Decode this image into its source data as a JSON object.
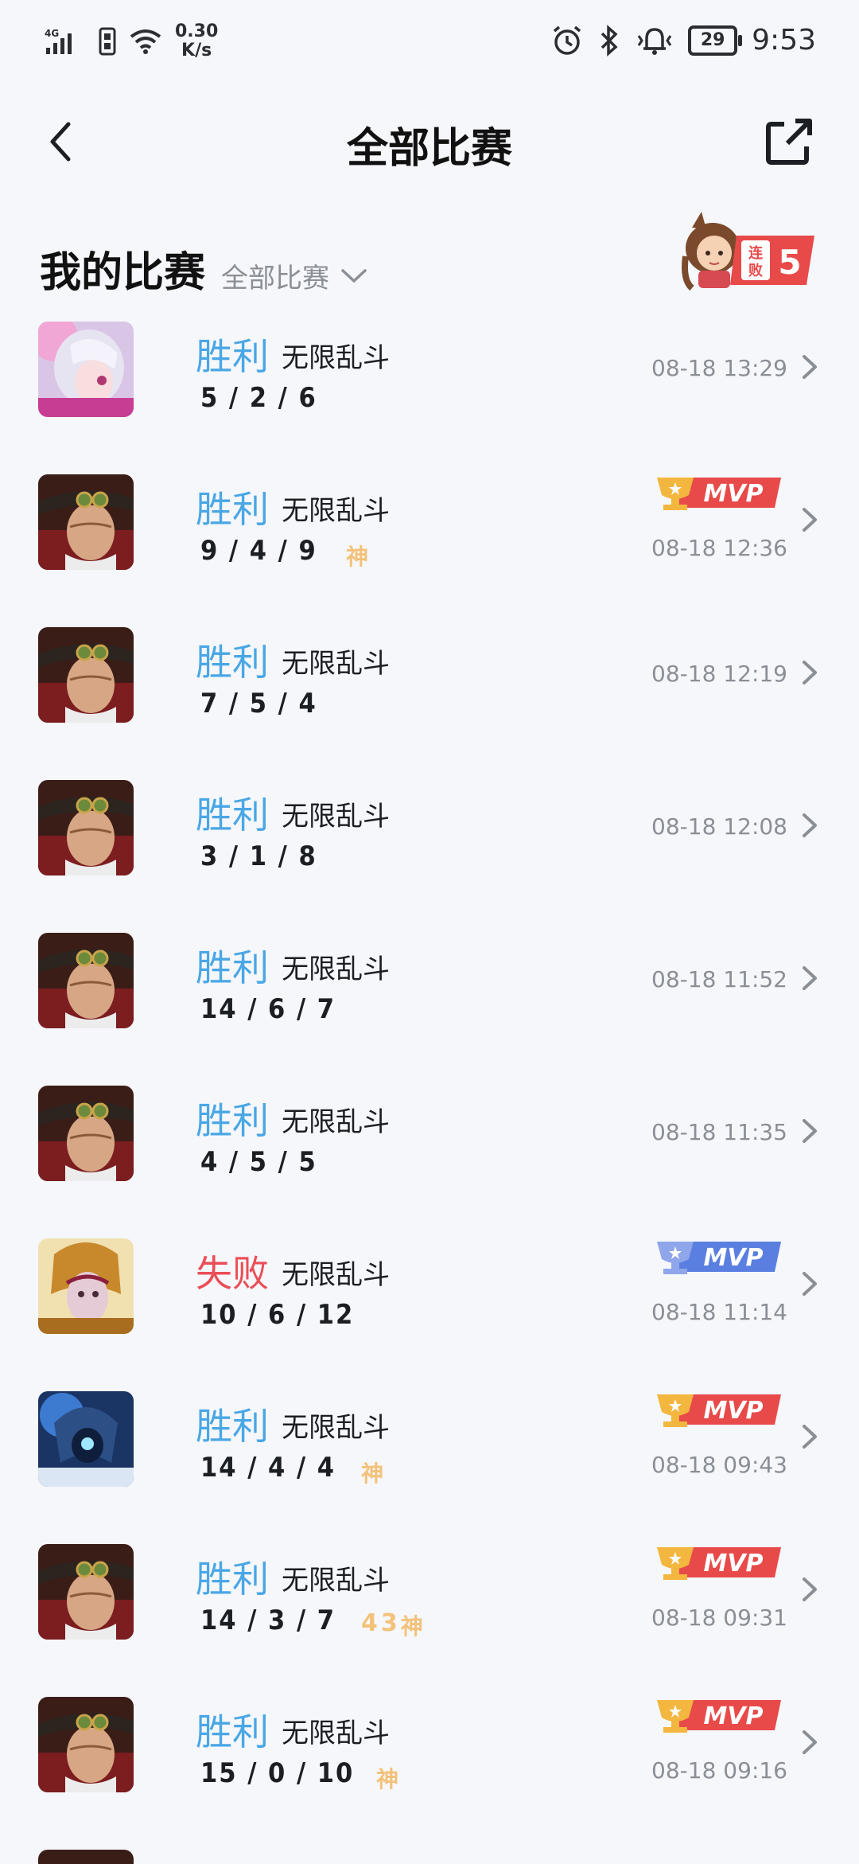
{
  "status_bar": {
    "network": "4G",
    "speed_value": "0.30",
    "speed_unit": "K/s",
    "battery": "29",
    "time": "9:53"
  },
  "header": {
    "title": "全部比赛"
  },
  "section": {
    "title": "我的比赛",
    "filter_label": "全部比赛",
    "streak": {
      "text_top": "连",
      "text_bottom": "败",
      "count": "5"
    }
  },
  "colors": {
    "win": "#49a7e6",
    "loss": "#ea4e57",
    "mvp_win": "#e84a4a",
    "mvp_loss": "#5a7fe0",
    "god": "#f3c27a"
  },
  "matches": [
    {
      "result": "胜利",
      "mode": "无限乱斗",
      "kda": "5 / 2 / 6",
      "time": "08-18 13:29",
      "hero": "pink-hair-hero"
    },
    {
      "result": "胜利",
      "mode": "无限乱斗",
      "kda": "9 / 4 / 9",
      "time": "08-18 12:36",
      "hero": "hat-hero",
      "mvp": "MVP",
      "god": "神"
    },
    {
      "result": "胜利",
      "mode": "无限乱斗",
      "kda": "7 / 5 / 4",
      "time": "08-18 12:19",
      "hero": "hat-hero"
    },
    {
      "result": "胜利",
      "mode": "无限乱斗",
      "kda": "3 / 1 / 8",
      "time": "08-18 12:08",
      "hero": "hat-hero"
    },
    {
      "result": "胜利",
      "mode": "无限乱斗",
      "kda": "14 / 6 / 7",
      "time": "08-18 11:52",
      "hero": "hat-hero"
    },
    {
      "result": "胜利",
      "mode": "无限乱斗",
      "kda": "4 / 5 / 5",
      "time": "08-18 11:35",
      "hero": "hat-hero"
    },
    {
      "result": "失败",
      "mode": "无限乱斗",
      "kda": "10 / 6 / 12",
      "time": "08-18 11:14",
      "hero": "gold-helmet-hero",
      "mvp": "MVP"
    },
    {
      "result": "胜利",
      "mode": "无限乱斗",
      "kda": "14 / 4 / 4",
      "time": "08-18 09:43",
      "hero": "blue-armor-hero",
      "mvp": "MVP",
      "god": "神"
    },
    {
      "result": "胜利",
      "mode": "无限乱斗",
      "kda": "14 / 3 / 7",
      "time": "08-18 09:31",
      "hero": "hat-hero",
      "mvp": "MVP",
      "multi": [
        "4",
        "3"
      ],
      "god": "神"
    },
    {
      "result": "胜利",
      "mode": "无限乱斗",
      "kda": "15 / 0 / 10",
      "time": "08-18 09:16",
      "hero": "hat-hero",
      "mvp": "MVP",
      "god": "神"
    }
  ]
}
